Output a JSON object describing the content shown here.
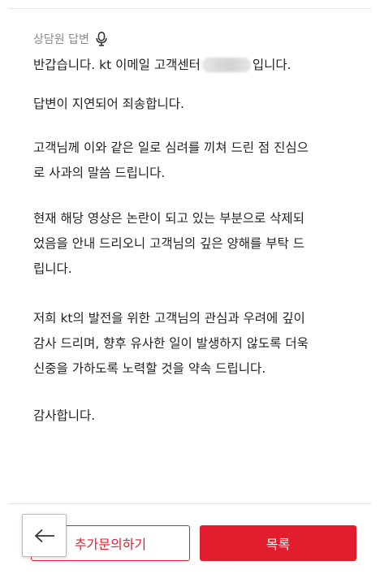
{
  "answer": {
    "label": "상담원 답변",
    "icon": "microphone-icon",
    "greeting_prefix": "반갑습니다. kt 이메일 고객센터",
    "greeting_suffix": "입니다.",
    "paragraphs": [
      [
        "답변이 지연되어 죄송합니다."
      ],
      [
        "고객님께 이와 같은 일로 심려를 끼쳐 드린 점 진심으",
        "로 사과의 말씀 드립니다."
      ],
      [
        "현재 해당 영상은 논란이 되고 있는 부분으로 삭제되",
        "었음을 안내 드리오니 고객님의 깊은 양해를 부탁 드",
        "립니다."
      ],
      [
        "저희 kt의 발전을 위한 고객님의 관심과 우려에 깊이",
        "감사 드리며, 향후 유사한 일이 발생하지 않도록 더욱",
        "신중을 가하도록 노력할 것을 약속 드립니다."
      ],
      [
        "감사합니다."
      ]
    ]
  },
  "actions": {
    "inquiry_label": "추가문의하기",
    "list_label": "목록",
    "back_icon": "arrow-left-icon"
  },
  "colors": {
    "accent": "#e21d2d",
    "muted": "#8a8a8a"
  }
}
